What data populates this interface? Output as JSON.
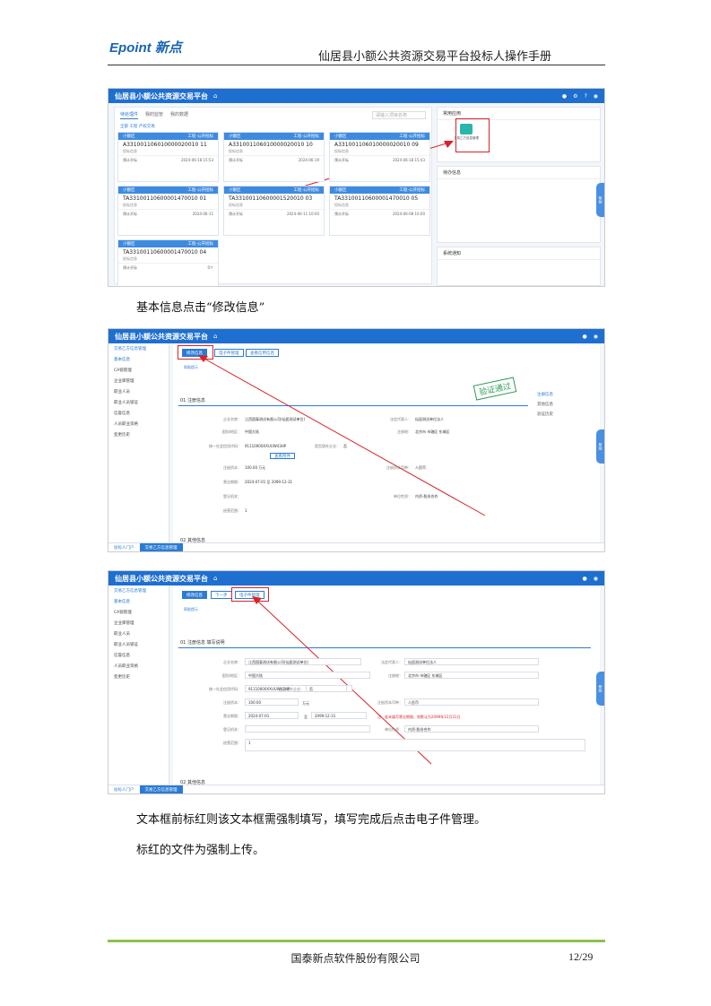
{
  "header": {
    "logo": "Epoint 新点",
    "title": "仙居县小额公共资源交易平台投标人操作手册"
  },
  "shot1": {
    "app_title": "仙居县小额公共资源交易平台",
    "tabs": [
      "待处理件",
      "我的监管",
      "我的数据"
    ],
    "filter": "全部  工程  产权交易",
    "search_placeholder": "请输入项目名称",
    "cards": [
      {
        "region": "小额区",
        "type": "工程-公开招标",
        "code": "A331001106010000020010 11",
        "sub": "投标信息",
        "r1": "预计开标",
        "r2": "2024-06-18 15:53"
      },
      {
        "region": "小额区",
        "type": "工程-公开招标",
        "code": "A331001106010000020010 10",
        "sub": "投标信息",
        "r1": "预计开标",
        "r2": "2024-06-19"
      },
      {
        "region": "小额区",
        "type": "工程-公开招标",
        "code": "A331001106010000020010 09",
        "sub": "投标信息",
        "r1": "预计开标",
        "r2": "2024-06-18 15:43"
      },
      {
        "region": "小额区",
        "type": "工程-公开招标",
        "code": "TA33100110600001470010 01",
        "sub": "投标信息",
        "r1": "预计开标",
        "r2": "2024-06-11"
      },
      {
        "region": "小额区",
        "type": "工程-公开招标",
        "code": "TA33100110600001520010 03",
        "sub": "投标信息",
        "r1": "预计开标",
        "r2": "2024-06-11 10:00"
      },
      {
        "region": "小额区",
        "type": "工程-公开招标",
        "code": "TA33100110600001470010 05",
        "sub": "投标信息",
        "r1": "预计开标",
        "r2": "2024-06-08 10:00"
      },
      {
        "region": "小额区",
        "type": "工程-公开招标",
        "code": "TA33100110600001470010 04",
        "sub": "投标信息",
        "r1": "预计开标",
        "r2": "0个"
      }
    ],
    "common_apps": "常用应用",
    "app_label": "交易乙方信息管理",
    "todo": "待办信息",
    "notice": "系统通知"
  },
  "caption1": "基本信息点击“修改信息”",
  "shot2": {
    "app_title": "仙居县小额公共资源交易平台",
    "menu": [
      "交易乙方信息管理",
      "基本信息",
      "CA锁管理",
      "企业库管理",
      "职业人员",
      "职业人员锁证",
      "信誉信息",
      "人员职业资格",
      "变更历史"
    ],
    "toolbar": [
      "修改信息",
      "电子件管理",
      "查看信用信息"
    ],
    "tip": "帮助提示",
    "section1": "01  注册信息",
    "section2": "02  其他信息",
    "right_nav": [
      "注册信息",
      "其他信息",
      "验证历史"
    ],
    "stamp": "验证通过",
    "fields": [
      {
        "label": "企业名称：",
        "value": "江西国泰测试有限公司(仙居测试单位)"
      },
      {
        "label": "国别/地区：",
        "value": "中国大陆"
      },
      {
        "label": "统一社会信用代码：",
        "value": "91110000XXUUW43HP"
      },
      {
        "label": "注册资本：",
        "value": "100.00 万元"
      },
      {
        "label": "营业期限：",
        "value": "2024-07-01  至  2099-12-31"
      },
      {
        "label": "登记机关：",
        "value": ""
      },
      {
        "label": "经营范围：",
        "value": "1"
      }
    ],
    "fields_right": [
      {
        "label": "法定代表人：",
        "value": "仙居测试单位法人"
      },
      {
        "label": "注册地：",
        "value": "北京市 市辖区 东城区"
      },
      {
        "label": "是否境外企业：",
        "value": "否"
      },
      {
        "label": "注册资本币种：",
        "value": "人民币"
      },
      {
        "label": "单位性质：",
        "value": "内资-股份合作"
      }
    ],
    "view_btn": "查看附件",
    "bottom": [
      "投标人门户",
      "交易乙方信息管理"
    ]
  },
  "shot3": {
    "app_title": "仙居县小额公共资源交易平台",
    "toolbar": [
      "修改信息",
      "下一步",
      "电子件管理"
    ],
    "section1": "01  注册信息  填写说明",
    "section2": "02  其他信息",
    "fields": [
      {
        "label": "企业名称：",
        "value": "江西国泰测试有限公司(仙居测试单位)"
      },
      {
        "label": "国别/地区：",
        "value": "中国大陆"
      },
      {
        "label": "统一社会信用代码：",
        "value": "91110000XXUUW43HP"
      },
      {
        "label": "注册资本：",
        "value": "100.00"
      },
      {
        "label": "营业期限：",
        "value": "2024-07-01"
      },
      {
        "label": "登记机关：",
        "value": ""
      },
      {
        "label": "经营范围：",
        "value": "1"
      }
    ],
    "unit": "万元",
    "to": "至",
    "end_date": "2099-12-31",
    "warning": "注：若未填写营业期限，则默认为2099年12月31日",
    "fields_right": [
      {
        "label": "法定代表人：",
        "value": "仙居测试单位法人"
      },
      {
        "label": "注册地：",
        "value": "北京市 市辖区 东城区"
      },
      {
        "label": "是否境外企业：",
        "value": "否"
      },
      {
        "label": "注册资本币种：",
        "value": "人民币"
      },
      {
        "label": "单位性质：",
        "value": "内资-股份合作"
      }
    ],
    "bottom": [
      "投标人门户",
      "交易乙方信息管理"
    ]
  },
  "caption2": "文本框前标红则该文本框需强制填写，填写完成后点击电子件管理。",
  "caption3": "标红的文件为强制上传。",
  "footer": {
    "company": "国泰新点软件股份有限公司",
    "page": "12/29"
  }
}
